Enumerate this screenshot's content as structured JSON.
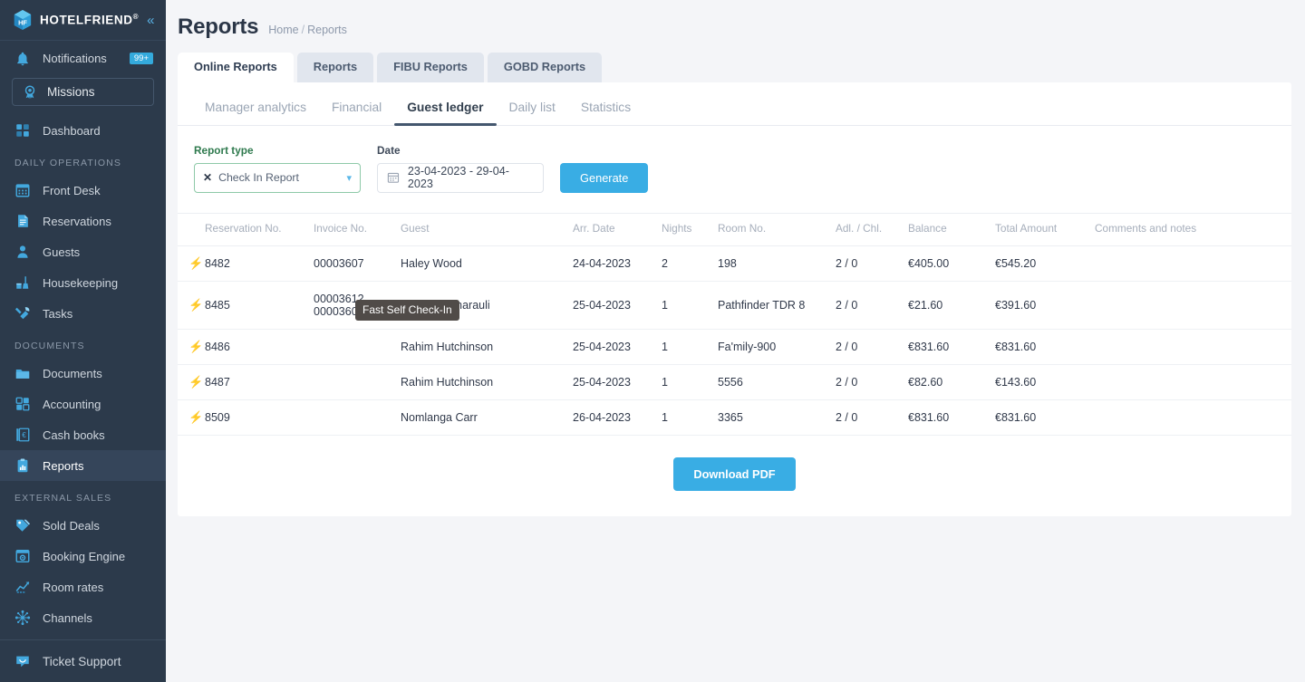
{
  "brand": {
    "name": "HOTELFRIEND",
    "registered": "®",
    "collapse_icon": "chevron-double-left-icon",
    "accent": "#34aadc",
    "sidebar_bg": "#2c3a4b"
  },
  "sidebar": {
    "notifications": {
      "label": "Notifications",
      "badge": "99+",
      "icon": "bell-icon"
    },
    "missions": {
      "label": "Missions",
      "icon": "award-ribbon-icon"
    },
    "dashboard": {
      "label": "Dashboard",
      "icon": "grid-squares-icon"
    },
    "groups": [
      {
        "title": "DAILY OPERATIONS",
        "items": [
          {
            "label": "Front Desk",
            "icon": "calendar-icon",
            "active": false
          },
          {
            "label": "Reservations",
            "icon": "document-lines-icon",
            "active": false
          },
          {
            "label": "Guests",
            "icon": "person-icon",
            "active": false
          },
          {
            "label": "Housekeeping",
            "icon": "broom-bucket-icon",
            "active": false
          },
          {
            "label": "Tasks",
            "icon": "wrench-screwdriver-icon",
            "active": false
          }
        ]
      },
      {
        "title": "DOCUMENTS",
        "items": [
          {
            "label": "Documents",
            "icon": "folder-icon",
            "active": false
          },
          {
            "label": "Accounting",
            "icon": "calculator-icon",
            "active": false
          },
          {
            "label": "Cash books",
            "icon": "euro-book-icon",
            "active": false
          },
          {
            "label": "Reports",
            "icon": "clipboard-chart-icon",
            "active": true
          }
        ]
      },
      {
        "title": "EXTERNAL SALES",
        "items": [
          {
            "label": "Sold Deals",
            "icon": "price-tags-icon",
            "active": false
          },
          {
            "label": "Booking Engine",
            "icon": "browser-gear-icon",
            "active": false
          },
          {
            "label": "Room rates",
            "icon": "chart-up-icon",
            "active": false
          },
          {
            "label": "Channels",
            "icon": "network-nodes-icon",
            "active": false
          }
        ]
      }
    ],
    "support": {
      "label": "Ticket Support",
      "icon": "chat-smile-icon"
    }
  },
  "header": {
    "title": "Reports",
    "breadcrumb": {
      "home": "Home",
      "separator": "/",
      "current": "Reports"
    }
  },
  "top_tabs": [
    {
      "label": "Online Reports",
      "active": true
    },
    {
      "label": "Reports",
      "active": false
    },
    {
      "label": "FIBU Reports",
      "active": false
    },
    {
      "label": "GOBD Reports",
      "active": false
    }
  ],
  "sub_tabs": [
    {
      "label": "Manager analytics",
      "active": false
    },
    {
      "label": "Financial",
      "active": false
    },
    {
      "label": "Guest ledger",
      "active": true
    },
    {
      "label": "Daily list",
      "active": false
    },
    {
      "label": "Statistics",
      "active": false
    }
  ],
  "filters": {
    "report_type": {
      "label": "Report type",
      "value": "Check In Report",
      "clear_icon": "close-x-icon",
      "caret_icon": "chevron-down-icon"
    },
    "date": {
      "label": "Date",
      "value": "23-04-2023 - 29-04-2023",
      "icon": "calendar-icon"
    },
    "generate_button": "Generate"
  },
  "tooltip": {
    "text": "Fast Self Check-In"
  },
  "table": {
    "columns": [
      "",
      "Reservation No.",
      "Invoice No.",
      "Guest",
      "Arr. Date",
      "Nights",
      "Room No.",
      "Adl. / Chl.",
      "Balance",
      "Total Amount",
      "Comments and notes"
    ],
    "rows": [
      {
        "bolt": "⚡",
        "reservation_no": "8482",
        "invoice_no": "00003607",
        "guest": "Haley Wood",
        "arr_date": "24-04-2023",
        "nights": "2",
        "room_no": "198",
        "adl_chl": "2 / 0",
        "balance": "€405.00",
        "total_amount": "€545.20",
        "comments": ""
      },
      {
        "bolt": "⚡",
        "reservation_no": "8485",
        "invoice_no": "00003612,\n00003609",
        "guest": "Martha Kamarauli",
        "arr_date": "25-04-2023",
        "nights": "1",
        "room_no": "Pathfinder TDR 8",
        "adl_chl": "2 / 0",
        "balance": "€21.60",
        "total_amount": "€391.60",
        "comments": ""
      },
      {
        "bolt": "⚡",
        "reservation_no": "8486",
        "invoice_no": "",
        "guest": "Rahim Hutchinson",
        "arr_date": "25-04-2023",
        "nights": "1",
        "room_no": "Fa'mily-900",
        "adl_chl": "2 / 0",
        "balance": "€831.60",
        "total_amount": "€831.60",
        "comments": ""
      },
      {
        "bolt": "⚡",
        "reservation_no": "8487",
        "invoice_no": "",
        "guest": "Rahim Hutchinson",
        "arr_date": "25-04-2023",
        "nights": "1",
        "room_no": "5556",
        "adl_chl": "2 / 0",
        "balance": "€82.60",
        "total_amount": "€143.60",
        "comments": ""
      },
      {
        "bolt": "⚡",
        "reservation_no": "8509",
        "invoice_no": "",
        "guest": "Nomlanga Carr",
        "arr_date": "26-04-2023",
        "nights": "1",
        "room_no": "3365",
        "adl_chl": "2 / 0",
        "balance": "€831.60",
        "total_amount": "€831.60",
        "comments": ""
      }
    ]
  },
  "download_button": "Download PDF"
}
